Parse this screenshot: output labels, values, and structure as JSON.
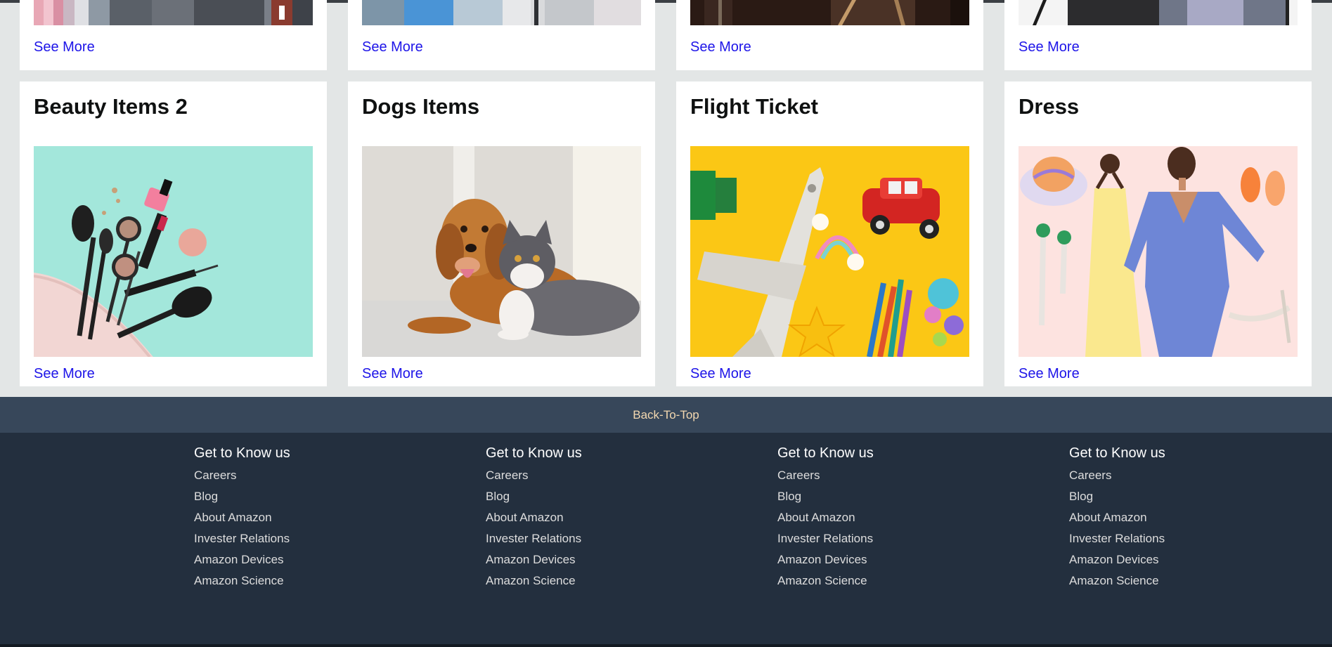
{
  "cards_row1": [
    {
      "see_more": "See More"
    },
    {
      "see_more": "See More"
    },
    {
      "see_more": "See More"
    },
    {
      "see_more": "See More"
    }
  ],
  "cards_row2": [
    {
      "title": "Beauty Items 2",
      "see_more": "See More"
    },
    {
      "title": "Dogs Items",
      "see_more": "See More"
    },
    {
      "title": "Flight Ticket",
      "see_more": "See More"
    },
    {
      "title": "Dress",
      "see_more": "See More"
    }
  ],
  "back_to_top": "Back-To-Top",
  "footer": {
    "columns": [
      {
        "heading": "Get to Know us",
        "links": [
          "Careers",
          "Blog",
          "About Amazon",
          "Invester Relations",
          "Amazon Devices",
          "Amazon Science"
        ]
      },
      {
        "heading": "Get to Know us",
        "links": [
          "Careers",
          "Blog",
          "About Amazon",
          "Invester Relations",
          "Amazon Devices",
          "Amazon Science"
        ]
      },
      {
        "heading": "Get to Know us",
        "links": [
          "Careers",
          "Blog",
          "About Amazon",
          "Invester Relations",
          "Amazon Devices",
          "Amazon Science"
        ]
      },
      {
        "heading": "Get to Know us",
        "links": [
          "Careers",
          "Blog",
          "About Amazon",
          "Invester Relations",
          "Amazon Devices",
          "Amazon Science"
        ]
      }
    ]
  },
  "colors": {
    "page_bg": "#e3e6e6",
    "link_blue": "#1d14e8",
    "back_to_top_bg": "#37475a",
    "back_to_top_text": "#f3d8b0",
    "footer_bg": "#232f3e"
  }
}
